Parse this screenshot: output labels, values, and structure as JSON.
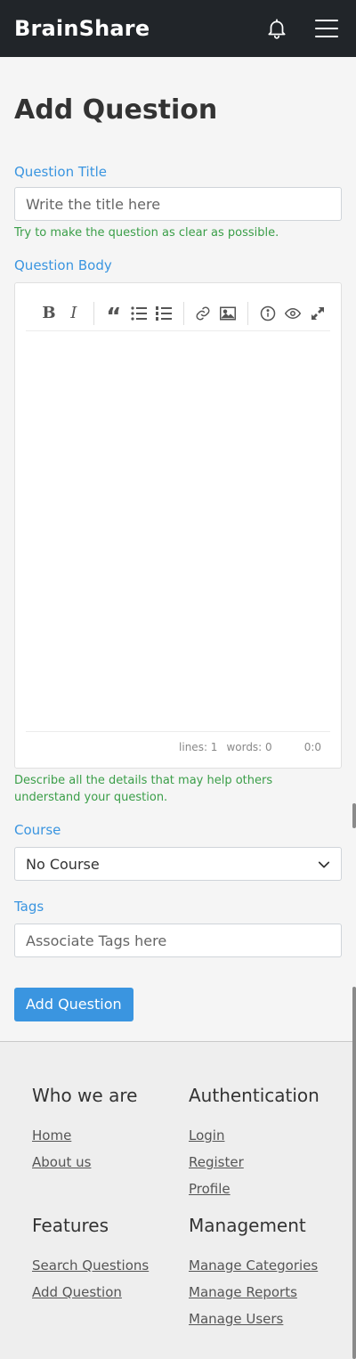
{
  "navbar": {
    "brand": "BrainShare",
    "bell_icon": "bell-icon",
    "menu_icon": "hamburger-icon"
  },
  "page": {
    "title": "Add Question"
  },
  "form": {
    "title_label": "Question Title",
    "title_placeholder": "Write the title here",
    "title_hint": "Try to make the question as clear as possible.",
    "body_label": "Question Body",
    "body_hint": "Describe all the details that may help others understand your question.",
    "editor": {
      "toolbar": [
        "bold-icon",
        "italic-icon",
        "quote-icon",
        "unordered-list-icon",
        "ordered-list-icon",
        "link-icon",
        "image-icon",
        "info-icon",
        "preview-icon",
        "fullscreen-icon"
      ],
      "status_lines": "lines: 1",
      "status_words": "words: 0",
      "status_cursor": "0:0"
    },
    "course_label": "Course",
    "course_selected": "No Course",
    "tags_label": "Tags",
    "tags_placeholder": "Associate Tags here",
    "submit_label": "Add Question"
  },
  "footer": {
    "who": {
      "heading": "Who we are",
      "links": [
        "Home",
        "About us"
      ]
    },
    "auth": {
      "heading": "Authentication",
      "links": [
        "Login",
        "Register",
        "Profile"
      ]
    },
    "features": {
      "heading": "Features",
      "links": [
        "Search Questions",
        "Add Question"
      ]
    },
    "management": {
      "heading": "Management",
      "links": [
        "Manage Categories",
        "Manage Reports",
        "Manage Users"
      ]
    }
  },
  "colors": {
    "navbar": "#212529",
    "accent": "#3a95e0",
    "hint": "#3a9e48",
    "background": "#f5f5f5"
  }
}
